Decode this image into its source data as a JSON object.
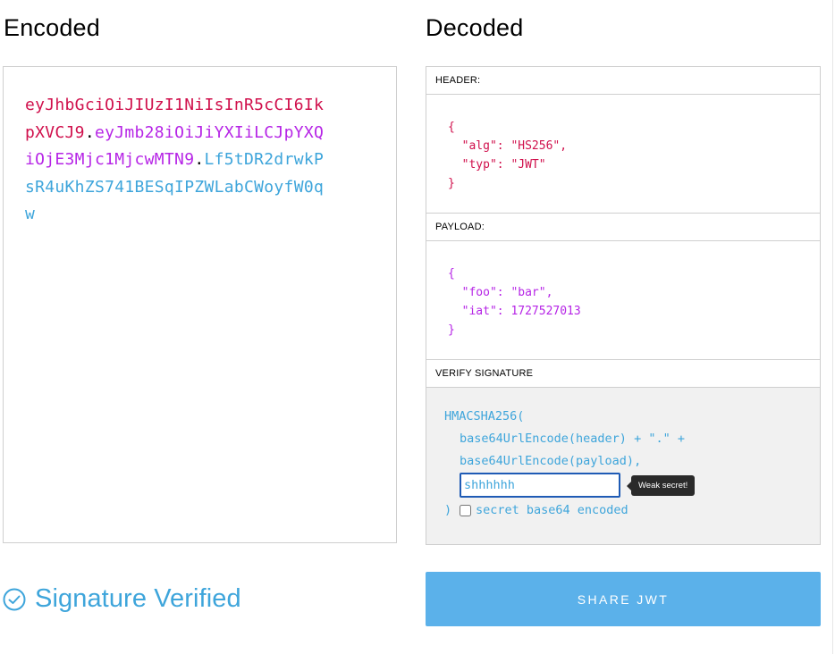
{
  "encoded": {
    "title": "Encoded",
    "token": {
      "header": "eyJhbGciOiJIUzI1NiIsInR5cCI6IkpXVCJ9",
      "payload": "eyJmb28iOiJiYXIiLCJpYXQiOjE3Mjc1MjcwMTN9",
      "signature": "Lf5tDR2drwkPsR4uKhZS741BESqIPZWLabCWoyfW0qw",
      "separator": "."
    }
  },
  "decoded": {
    "title": "Decoded",
    "header": {
      "label": "HEADER:",
      "open": "{",
      "close": "}",
      "lines": [
        "  \"alg\": \"HS256\",",
        "  \"typ\": \"JWT\""
      ]
    },
    "payload": {
      "label": "PAYLOAD:",
      "open": "{",
      "close": "}",
      "lines": [
        "  \"foo\": \"bar\",",
        "  \"iat\": 1727527013"
      ]
    },
    "verify": {
      "label": "VERIFY SIGNATURE",
      "line1": "HMACSHA256(",
      "line2": "base64UrlEncode(header) + \".\" +",
      "line3": "base64UrlEncode(payload),",
      "secret_value": "shhhhhh",
      "tooltip": "Weak secret!",
      "close_paren": ")",
      "checkbox_label": "secret base64 encoded",
      "checkbox_checked": false
    }
  },
  "status": {
    "text": "Signature Verified",
    "icon": "check-circle-icon"
  },
  "share_button": {
    "label": "SHARE JWT"
  },
  "colors": {
    "header": "#d0104c",
    "payload": "#b625e6",
    "signature": "#3ea5db",
    "button": "#5bb1ea"
  }
}
